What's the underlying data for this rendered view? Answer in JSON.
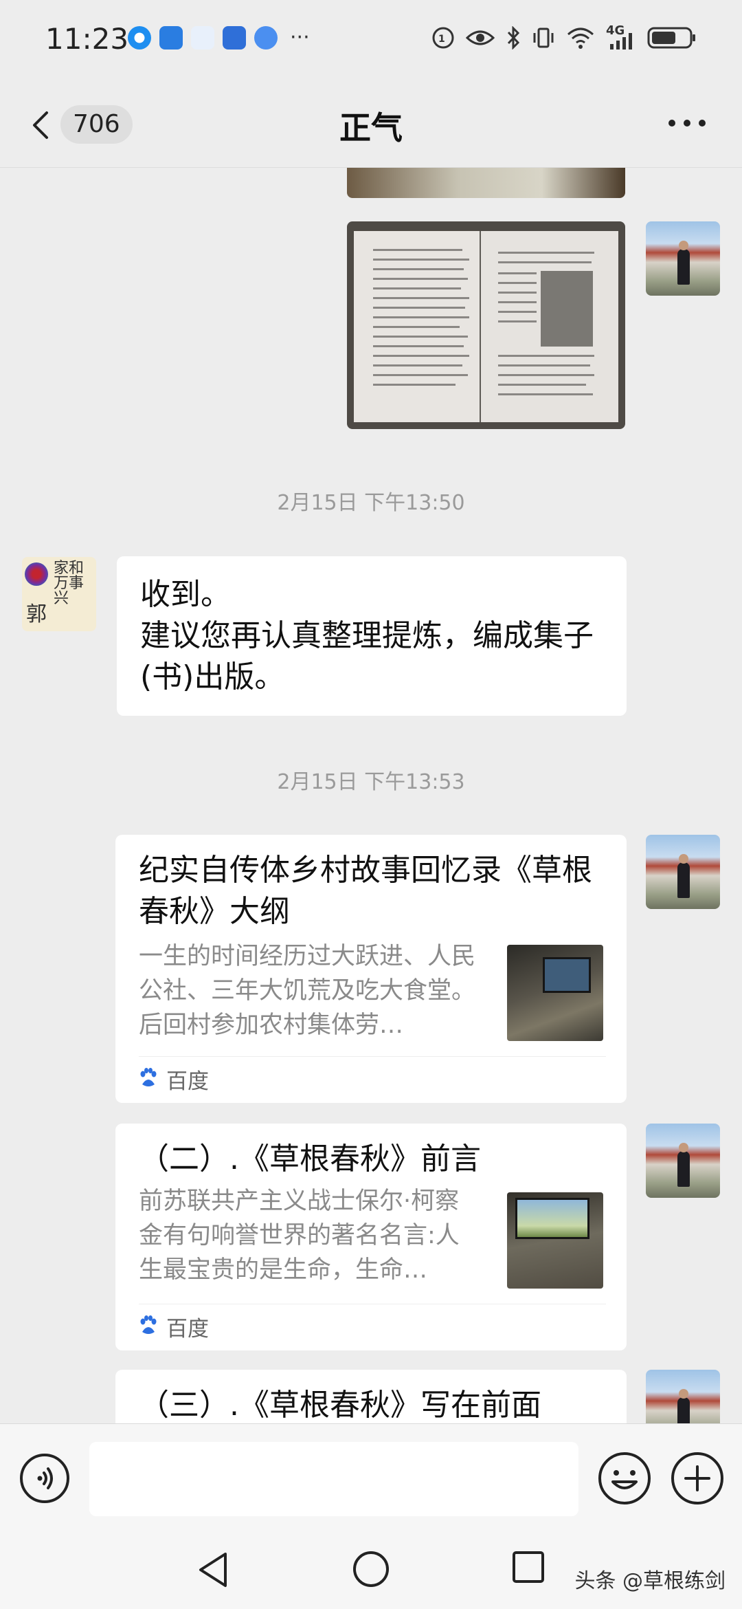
{
  "status_bar": {
    "time": "11:23",
    "more": "···",
    "network": "4G"
  },
  "header": {
    "back_count": "706",
    "title": "正气"
  },
  "messages": {
    "sep1": "2月15日 下午13:50",
    "reply_line1": "收到。",
    "reply_line2": "建议您再认真整理提炼，编成集子(书)出版。",
    "sep2": "2月15日 下午13:53",
    "card1": {
      "title": "纪实自传体乡村故事回忆录《草根春秋》大纲",
      "desc": "一生的时间经历过大跃进、人民公社、三年大饥荒及吃大食堂。后回村参加农村集体劳…",
      "source": "百度"
    },
    "card2": {
      "title": "（二）.《草根春秋》前言",
      "desc": "前苏联共产主义战士保尔·柯察金有句响誉世界的著名名言:人生最宝贵的是生命，生命…",
      "source": "百度"
    },
    "card3": {
      "title": "（三）.《草根春秋》写在前面"
    }
  },
  "left_avatar": {
    "char": "郭",
    "calligraphy": "家和万事兴"
  },
  "watermark": "头条 @草根练剑",
  "colors": {
    "background": "#ededed",
    "bubble": "#ffffff",
    "time_text": "#9a9a9a",
    "desc_text": "#8a8a8a"
  }
}
